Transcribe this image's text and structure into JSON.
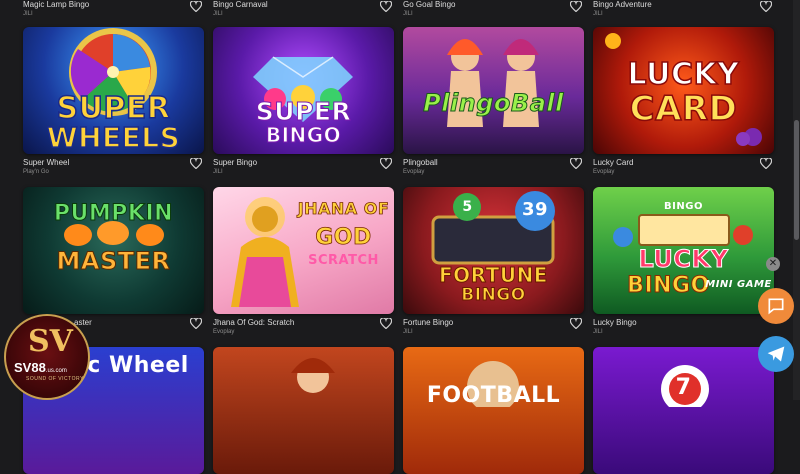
{
  "top_row": [
    {
      "name": "Magic Lamp Bingo",
      "provider": "JILI"
    },
    {
      "name": "Bingo Carnaval",
      "provider": "JILI"
    },
    {
      "name": "Go Goal Bingo",
      "provider": "JILI"
    },
    {
      "name": "Bingo Adventure",
      "provider": "JILI"
    }
  ],
  "row1": [
    {
      "name": "Super Wheel",
      "provider": "Play'n Go",
      "art_line1": "SUPER",
      "art_line2": "WHEELS"
    },
    {
      "name": "Super Bingo",
      "provider": "JILI",
      "art_line1": "SUPER",
      "art_line2": "BINGO"
    },
    {
      "name": "Plingoball",
      "provider": "Evoplay",
      "art_line1": "PlingoBall",
      "art_line2": ""
    },
    {
      "name": "Lucky Card",
      "provider": "Evoplay",
      "art_line1": "LUCKY",
      "art_line2": "CARD"
    }
  ],
  "row2": [
    {
      "name": "Pumpkin Master",
      "provider": "",
      "art_line1": "PUMPKIN",
      "art_line2": "MASTER"
    },
    {
      "name": "Jhana Of God: Scratch",
      "provider": "Evoplay",
      "art_line1": "JHANA OF",
      "art_line2": "GOD"
    },
    {
      "name": "Fortune Bingo",
      "provider": "JILI",
      "art_line1": "FORTUNE",
      "art_line2": "BINGO"
    },
    {
      "name": "Lucky Bingo",
      "provider": "JILI",
      "art_line1": "LUCKY",
      "art_line2": "BINGO"
    }
  ],
  "row2_visible_caption_0": "aster",
  "row2_art_extras": {
    "jhana_scratch": "SCRATCH",
    "fortune_ball1": "5",
    "fortune_ball2": "39",
    "lucky_top": "BINGO",
    "lucky_mini": "MINI GAME"
  },
  "row3": [
    {
      "art_line1": "gic Wheel"
    },
    {
      "art_line1": ""
    },
    {
      "art_line1": "FOOTBALL"
    },
    {
      "art_line1": "7"
    }
  ],
  "logo": {
    "mark": "SV",
    "brand": "SV88",
    "brand_suffix": ".us.com",
    "slogan": "SOUND OF VICTORY"
  },
  "colors": {
    "background": "#1b1b1d",
    "caption": "#dcdcdc",
    "provider": "#8c8c8c",
    "chat_button": "#f08a3a",
    "telegram_button": "#3a9ae0"
  },
  "icons": {
    "favorite": "heart-icon",
    "close": "close-icon",
    "chat": "chat-icon",
    "telegram": "telegram-icon"
  }
}
